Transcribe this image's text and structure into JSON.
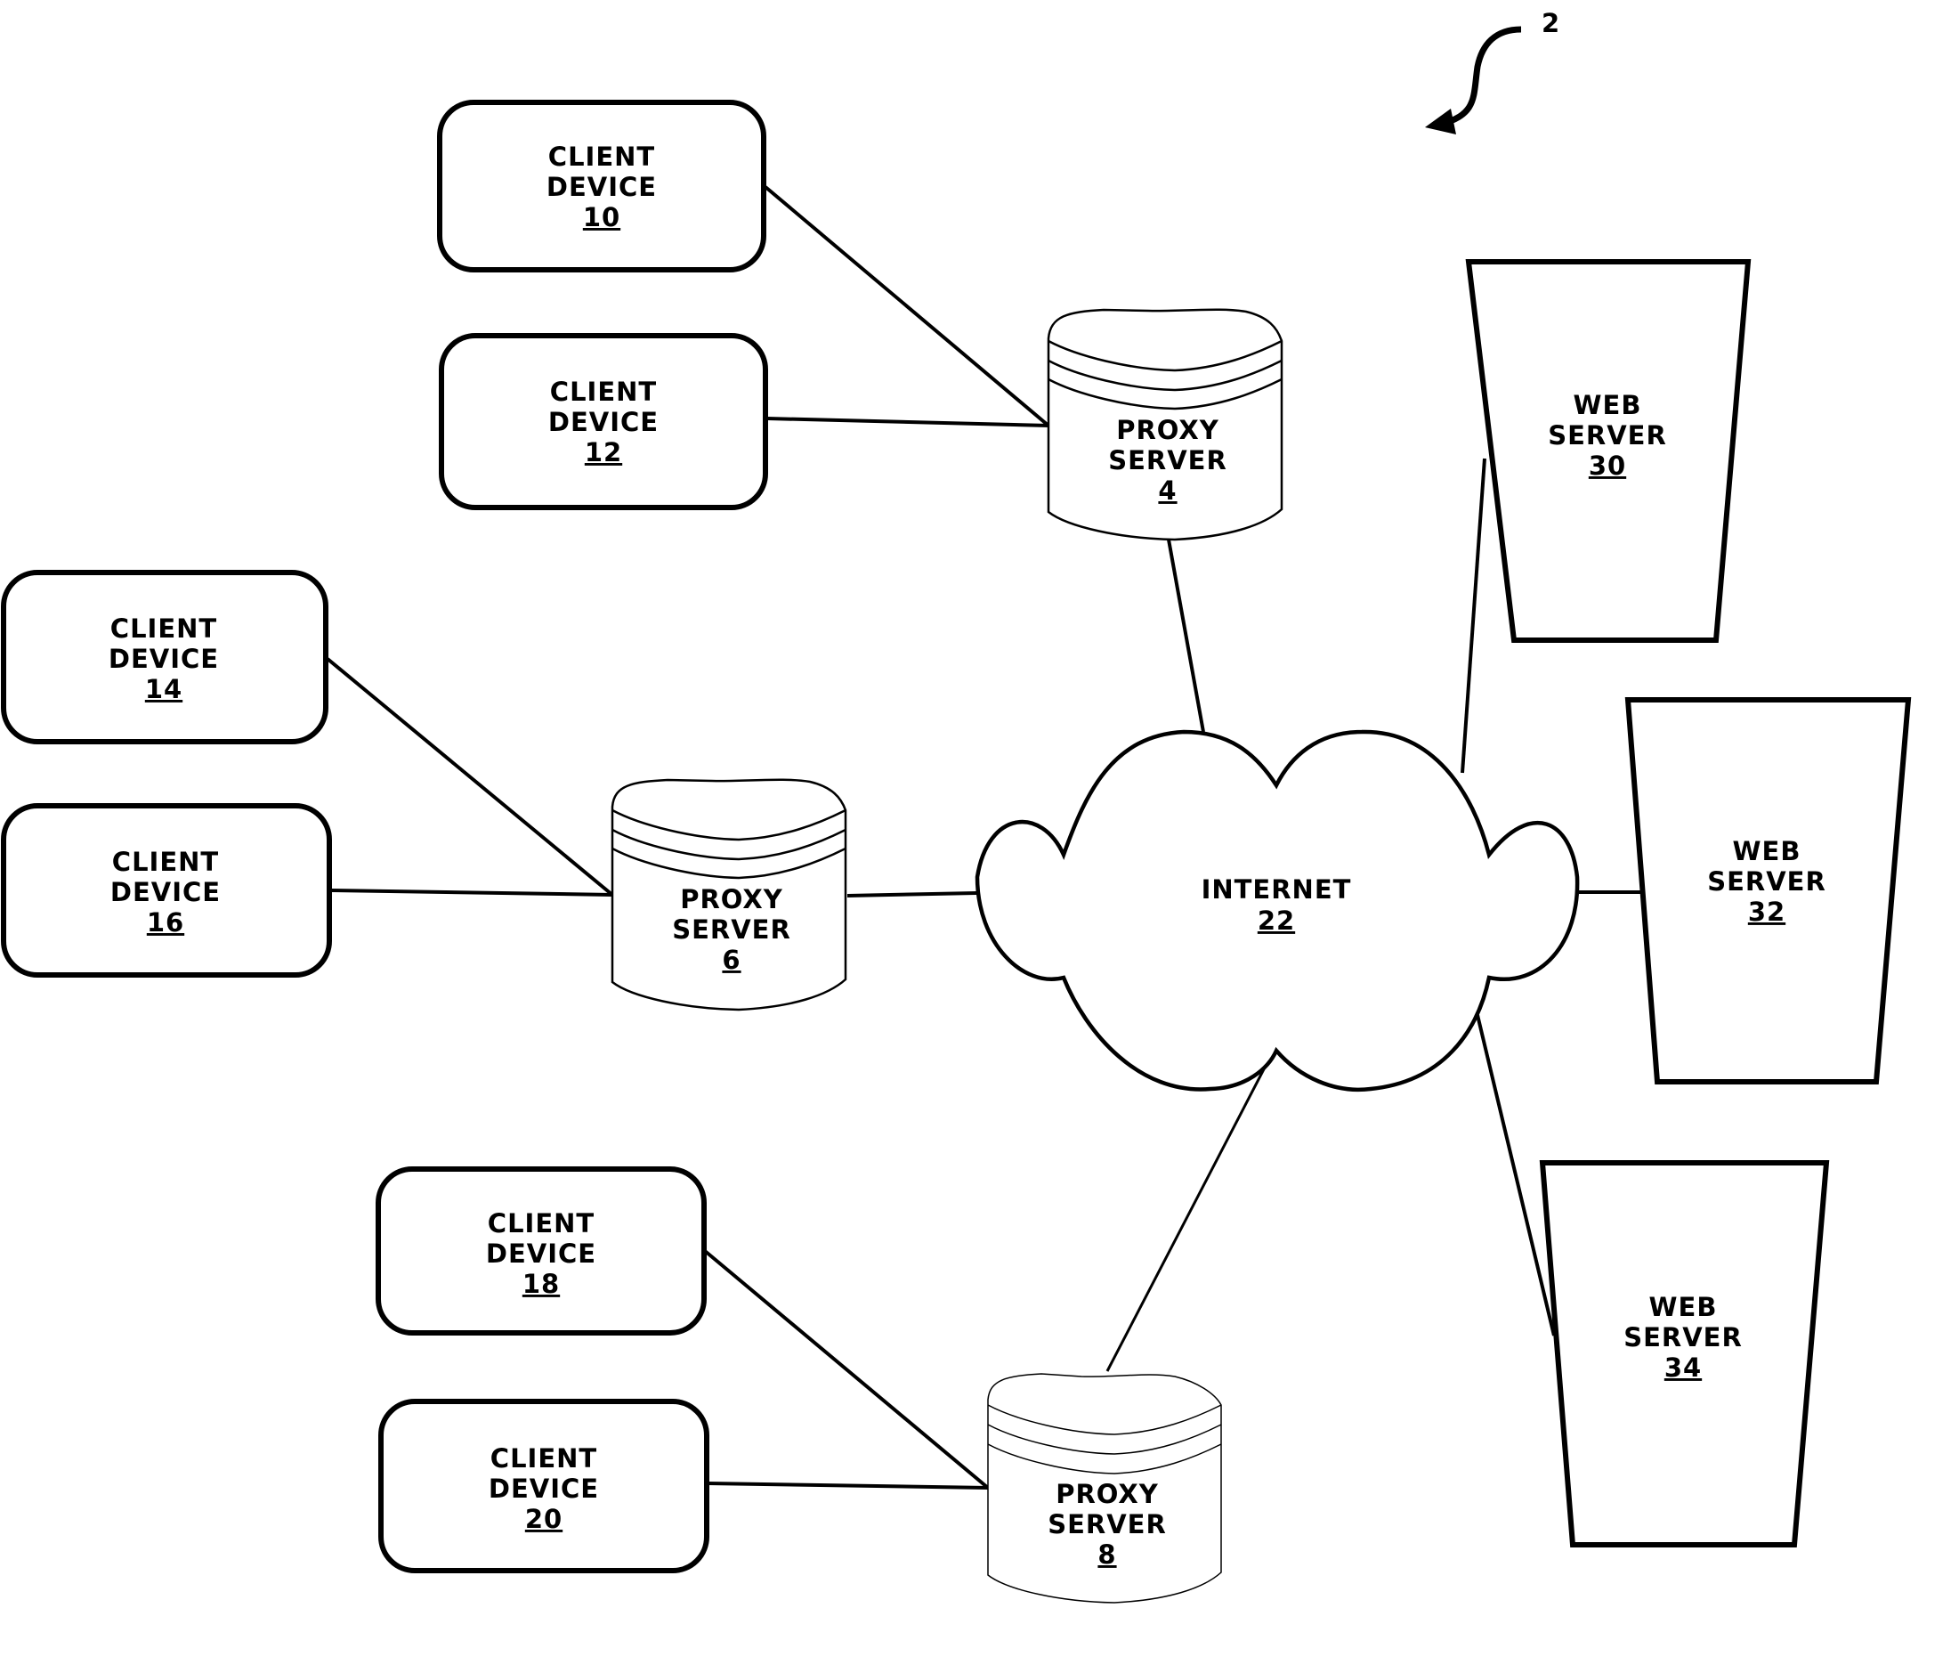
{
  "figure": {
    "reference_numeral": "2"
  },
  "colors": {
    "stroke": "#000000",
    "background": "#ffffff"
  },
  "nodes": {
    "client_10": {
      "line1": "CLIENT",
      "line2": "DEVICE",
      "ref": "10"
    },
    "client_12": {
      "line1": "CLIENT",
      "line2": "DEVICE",
      "ref": "12"
    },
    "client_14": {
      "line1": "CLIENT",
      "line2": "DEVICE",
      "ref": "14"
    },
    "client_16": {
      "line1": "CLIENT",
      "line2": "DEVICE",
      "ref": "16"
    },
    "client_18": {
      "line1": "CLIENT",
      "line2": "DEVICE",
      "ref": "18"
    },
    "client_20": {
      "line1": "CLIENT",
      "line2": "DEVICE",
      "ref": "20"
    },
    "proxy_4": {
      "line1": "PROXY",
      "line2": "SERVER",
      "ref": "4"
    },
    "proxy_6": {
      "line1": "PROXY",
      "line2": "SERVER",
      "ref": "6"
    },
    "proxy_8": {
      "line1": "PROXY",
      "line2": "SERVER",
      "ref": "8"
    },
    "internet_22": {
      "line1": "INTERNET",
      "ref": "22"
    },
    "web_30": {
      "line1": "WEB",
      "line2": "SERVER",
      "ref": "30"
    },
    "web_32": {
      "line1": "WEB",
      "line2": "SERVER",
      "ref": "32"
    },
    "web_34": {
      "line1": "WEB",
      "line2": "SERVER",
      "ref": "34"
    }
  },
  "connections": [
    {
      "from": "client_10",
      "to": "proxy_4"
    },
    {
      "from": "client_12",
      "to": "proxy_4"
    },
    {
      "from": "client_14",
      "to": "proxy_6"
    },
    {
      "from": "client_16",
      "to": "proxy_6"
    },
    {
      "from": "client_18",
      "to": "proxy_8"
    },
    {
      "from": "client_20",
      "to": "proxy_8"
    },
    {
      "from": "proxy_4",
      "to": "internet_22"
    },
    {
      "from": "proxy_6",
      "to": "internet_22"
    },
    {
      "from": "proxy_8",
      "to": "internet_22"
    },
    {
      "from": "internet_22",
      "to": "web_30"
    },
    {
      "from": "internet_22",
      "to": "web_32"
    },
    {
      "from": "internet_22",
      "to": "web_34"
    }
  ]
}
